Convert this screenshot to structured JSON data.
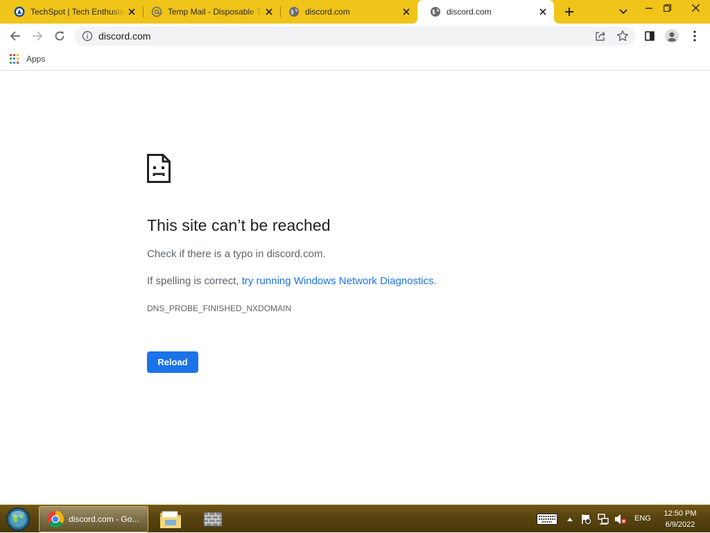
{
  "tabs": [
    {
      "title": "TechSpot | Tech Enthusiasts, Power Users, Gamers",
      "favicon": "techspot-icon"
    },
    {
      "title": "Temp Mail - Disposable Temporary Email",
      "favicon": "at-sign-icon"
    },
    {
      "title": "discord.com",
      "favicon": "globe-icon"
    },
    {
      "title": "discord.com",
      "favicon": "globe-icon",
      "active": true
    }
  ],
  "omnibox": {
    "url": "discord.com"
  },
  "bookmarks": {
    "apps_label": "Apps"
  },
  "error": {
    "title": "This site can’t be reached",
    "line1": "Check if there is a typo in discord.com.",
    "line2_prefix": "If spelling is correct, ",
    "line2_link": "try running Windows Network Diagnostics",
    "line2_suffix": ".",
    "code": "DNS_PROBE_FINISHED_NXDOMAIN",
    "reload_label": "Reload"
  },
  "taskbar": {
    "active_window_label": "discord.com - Go...",
    "language": "ENG",
    "time": "12:50 PM",
    "date": "6/9/2022"
  },
  "colors": {
    "tabstrip": "#f0c419",
    "link": "#1a73e8",
    "button": "#1a73e8",
    "taskbar": "#574310"
  }
}
